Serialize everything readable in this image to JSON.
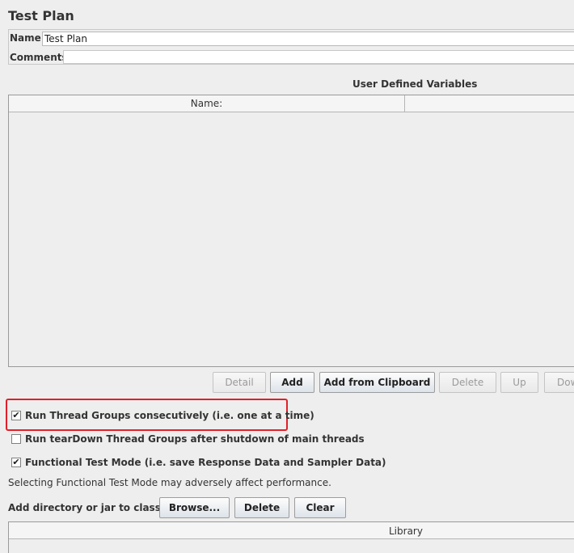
{
  "panel": {
    "title": "Test Plan",
    "name_label": "Name:",
    "name_value": "Test Plan",
    "comments_label": "Comments:"
  },
  "variables": {
    "title": "User Defined Variables",
    "columns": [
      "Name:",
      ""
    ],
    "rows": []
  },
  "table_buttons": [
    {
      "label": "Detail",
      "enabled": false
    },
    {
      "label": "Add",
      "enabled": true
    },
    {
      "label": "Add from Clipboard",
      "enabled": true
    },
    {
      "label": "Delete",
      "enabled": false
    },
    {
      "label": "Up",
      "enabled": false
    },
    {
      "label": "Dow",
      "enabled": false
    }
  ],
  "options": [
    {
      "label": "Run Thread Groups consecutively (i.e. one at a time)",
      "checked": true,
      "highlighted": true
    },
    {
      "label": "Run tearDown Thread Groups after shutdown of main threads",
      "checked": false,
      "highlighted": false
    },
    {
      "label": "Functional Test Mode (i.e. save Response Data and Sampler Data)",
      "checked": true,
      "highlighted": false
    }
  ],
  "functional_note": "Selecting Functional Test Mode may adversely affect performance.",
  "classpath": {
    "label": "Add directory or jar to classpath",
    "browse_label": "Browse...",
    "delete_label": "Delete",
    "clear_label": "Clear",
    "library_column": "Library"
  },
  "colors": {
    "highlight": "#e0202a",
    "background": "#eeeeee"
  }
}
